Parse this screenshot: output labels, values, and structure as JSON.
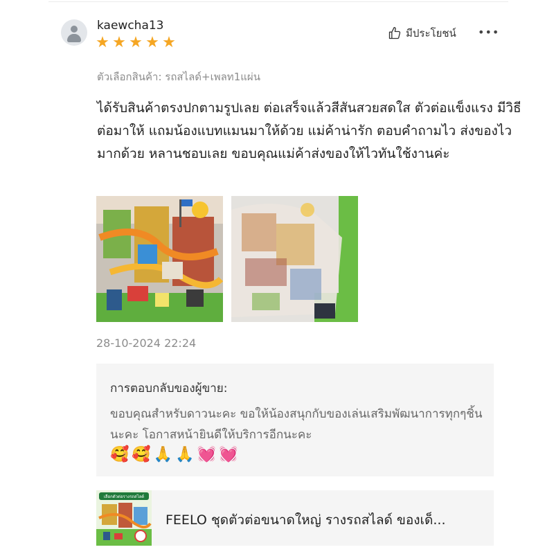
{
  "review": {
    "username": "kaewcha13",
    "rating": 5,
    "stars": [
      "★",
      "★",
      "★",
      "★",
      "★"
    ],
    "helpful_label": "มีประโยชน์",
    "more_label": "•••",
    "variant": "ตัวเลือกสินค้า: รถสไลด์+เพลท1แผ่น",
    "text": "ได้รับสินค้าตรงปกตามรูปเลย ต่อเสร็จแล้วสีสันสวยสดใส ตัวต่อแข็งแรง มีวิธีต่อมาให้ แถมน้องแบทแมนมาให้ด้วย แม่ค้าน่ารัก ตอบคำถามไว ส่งของไวมากด้วย หลานชอบเลย ขอบคุณแม่ค้าส่งของให้ไวทันใช้งานค่ะ",
    "timestamp": "28-10-2024 22:24"
  },
  "seller_reply": {
    "title": "การตอบกลับของผู้ขาย:",
    "text": "ขอบคุณสำหรับดาวนะคะ ขอให้น้องสนุกกับของเล่นเสริมพัฒนาการทุกๆชิ้นนะคะ โอกาสหน้ายินดีให้บริการอีกนะคะ",
    "emojis": [
      "🥰",
      "🥰",
      "🙏",
      "🙏",
      "💓",
      "💓"
    ]
  },
  "product": {
    "thumb_text": "เลือกตัวต่อรางรถสไลด์",
    "name": "FEELO ชุดตัวต่อขนาดใหญ่ รางรถสไลด์ ของเด็..."
  },
  "colors": {
    "star": "#f5a623",
    "muted_text": "#8c8c8c",
    "box_background": "#f5f5f5"
  }
}
